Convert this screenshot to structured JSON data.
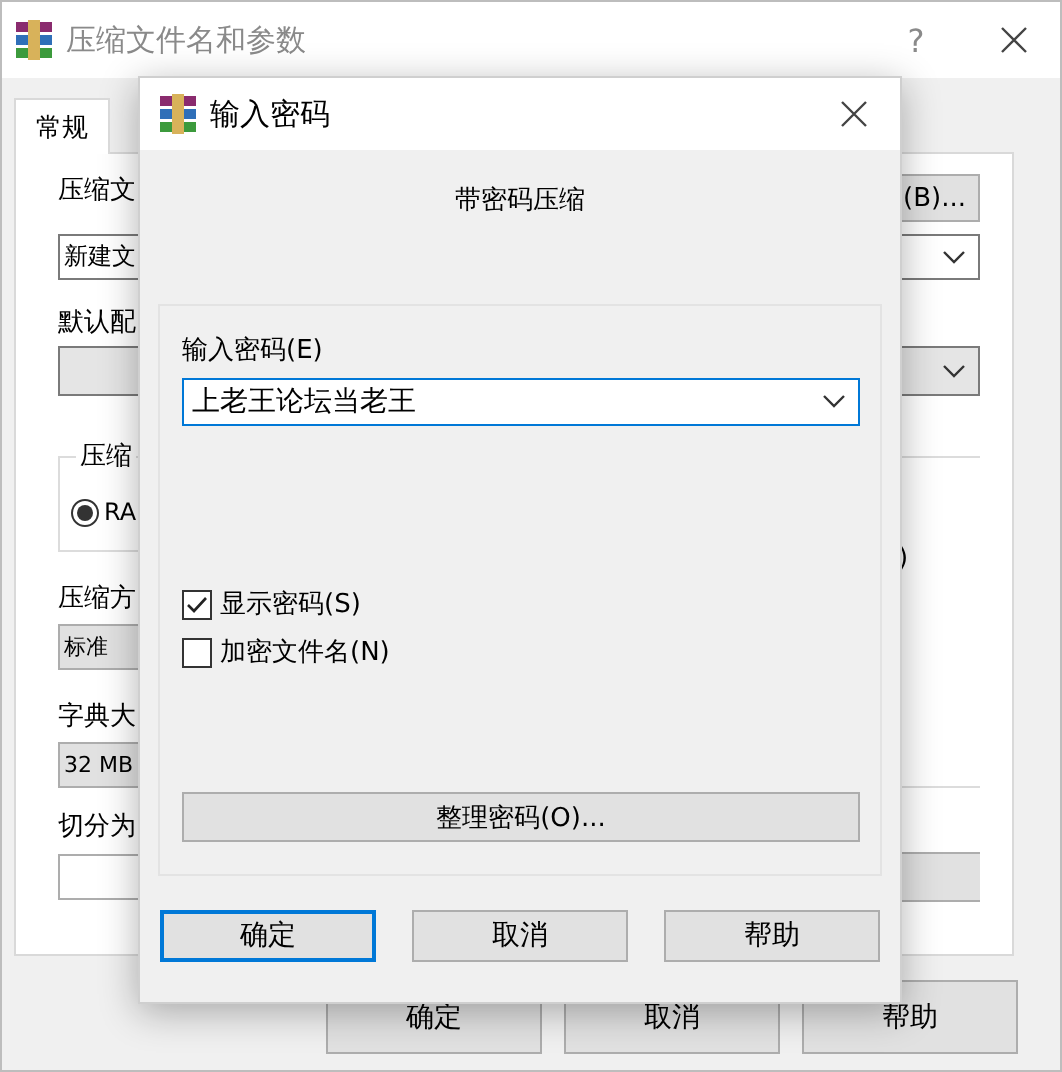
{
  "main_window": {
    "title": "压缩文件名和参数",
    "help": "?",
    "tabs": [
      {
        "label": "常规",
        "selected": true
      }
    ],
    "archive_name": {
      "label": "压缩文",
      "browse": "(B)...",
      "value": "新建文"
    },
    "profile": {
      "label": "默认配"
    },
    "format_group": {
      "label": "压缩",
      "option": {
        "label": "RA",
        "selected": true
      }
    },
    "options_group": {
      "text": ")"
    },
    "method": {
      "label": "压缩方",
      "value": "标准"
    },
    "dictionary": {
      "label": "字典大",
      "value": "32 MB"
    },
    "split": {
      "label": "切分为"
    },
    "buttons": [
      "确定",
      "取消",
      "帮助"
    ]
  },
  "dialog": {
    "title": "输入密码",
    "heading": "带密码压缩",
    "password": {
      "label": "输入密码(E)",
      "value": "上老王论坛当老王"
    },
    "checkboxes": [
      {
        "label": "显示密码(S)",
        "checked": true
      },
      {
        "label": "加密文件名(N)",
        "checked": false
      }
    ],
    "organize": "整理密码(O)...",
    "buttons": [
      {
        "label": "确定",
        "default": true
      },
      {
        "label": "取消",
        "default": false
      },
      {
        "label": "帮助",
        "default": false
      }
    ]
  }
}
